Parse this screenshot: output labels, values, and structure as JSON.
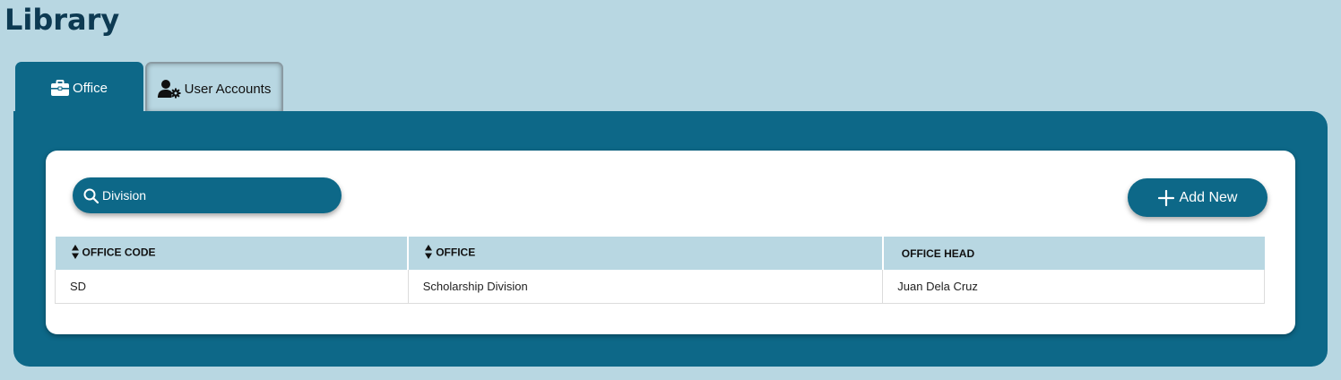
{
  "page": {
    "title": "Library"
  },
  "tabs": [
    {
      "label": "Office",
      "icon": "briefcase-icon",
      "active": true
    },
    {
      "label": "User Accounts",
      "icon": "user-gear-icon",
      "active": false
    }
  ],
  "search": {
    "value": "Division",
    "placeholder": "",
    "icon": "search-icon"
  },
  "toolbar": {
    "add_label": "Add New",
    "add_icon": "plus-icon"
  },
  "table": {
    "columns": [
      {
        "label": "OFFICE CODE",
        "sortable": true
      },
      {
        "label": "OFFICE",
        "sortable": true
      },
      {
        "label": "OFFICE HEAD",
        "sortable": false
      }
    ],
    "rows": [
      {
        "code": "SD",
        "office": "Scholarship Division",
        "head": "Juan Dela Cruz"
      }
    ]
  },
  "colors": {
    "background": "#b8d7e2",
    "primary": "#0d6888",
    "title": "#0d3a52",
    "card": "#ffffff",
    "header_row": "#b8d7e2"
  }
}
